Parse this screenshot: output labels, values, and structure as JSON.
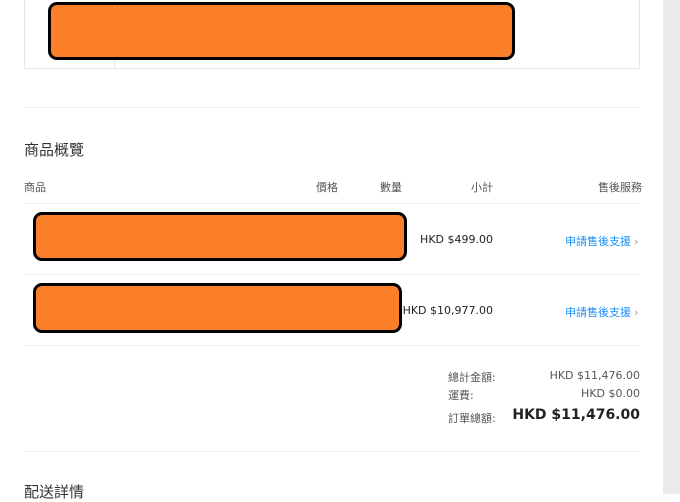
{
  "address_section": {},
  "product_overview": {
    "title": "商品概覽",
    "columns": {
      "product": "商品",
      "price": "價格",
      "quantity": "數量",
      "subtotal": "小計",
      "after_sales": "售後服務"
    },
    "items": [
      {
        "subtotal": "HKD $499.00",
        "action": "申請售後支援",
        "chevron": "›"
      },
      {
        "subtotal": "HKD $10,977.00",
        "action": "申請售後支援",
        "chevron": "›"
      }
    ]
  },
  "summary": {
    "total_label": "總計金額:",
    "total_value": "HKD $11,476.00",
    "shipping_label": "運費:",
    "shipping_value": "HKD $0.00",
    "grand_label": "訂單總額:",
    "grand_value": "HKD $11,476.00"
  },
  "delivery": {
    "title": "配送詳情"
  },
  "colors": {
    "accent_link": "#1a8ff5",
    "redaction": "#fb7f28"
  }
}
